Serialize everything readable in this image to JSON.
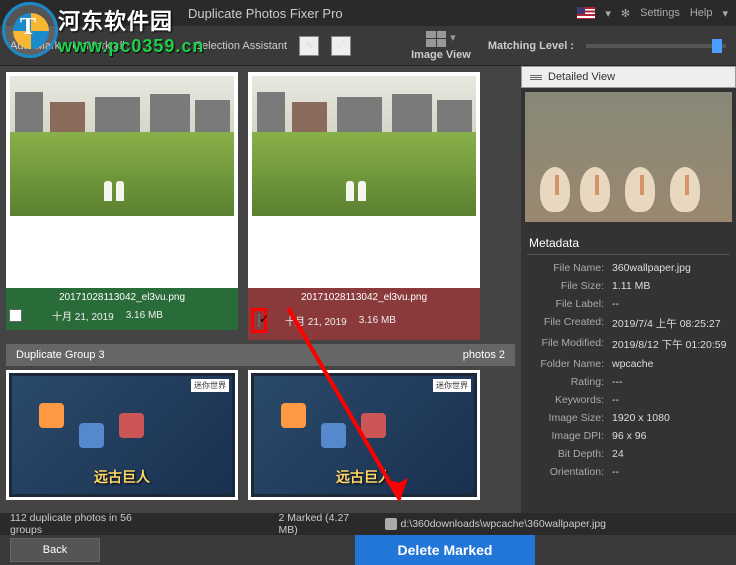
{
  "title": "Duplicate Photos Fixer Pro",
  "titlebar": {
    "settings": "Settings",
    "help": "Help",
    "locale": "en-US"
  },
  "toolbar": {
    "automark": "Auto Mark",
    "unmarkall": "UnMark all",
    "selection": "Selection Assistant",
    "imageview": "Image View",
    "matching": "Matching Level :"
  },
  "photos": [
    {
      "filename": "20171028113042_el3vu.png",
      "date": "十月 21, 2019",
      "size": "3.16 MB",
      "checked": false
    },
    {
      "filename": "20171028113042_el3vu.png",
      "date": "十月 21, 2019",
      "size": "3.16 MB",
      "checked": true
    }
  ],
  "group": {
    "label": "Duplicate Group 3",
    "count": "photos 2"
  },
  "game": {
    "title": "远古巨人",
    "badge": "迷你世界"
  },
  "detail": {
    "label": "Detailed View"
  },
  "metadata": {
    "title": "Metadata",
    "rows": [
      {
        "k": "File Name:",
        "v": "360wallpaper.jpg"
      },
      {
        "k": "File Size:",
        "v": "1.11 MB"
      },
      {
        "k": "File Label:",
        "v": "--"
      },
      {
        "k": "File Created:",
        "v": "2019/7/4 上午 08:25:27"
      },
      {
        "k": "File Modified:",
        "v": "2019/8/12 下午 01:20:59"
      },
      {
        "k": "Folder Name:",
        "v": "wpcache"
      },
      {
        "k": "Rating:",
        "v": "---"
      },
      {
        "k": "Keywords:",
        "v": "--"
      },
      {
        "k": "Image Size:",
        "v": "1920 x 1080"
      },
      {
        "k": "Image DPI:",
        "v": "96 x 96"
      },
      {
        "k": "Bit Depth:",
        "v": "24"
      },
      {
        "k": "Orientation:",
        "v": "--"
      }
    ]
  },
  "status": {
    "groups": "112 duplicate photos in 56 groups",
    "marked": "2 Marked (4.27 MB)",
    "path": "d:\\360downloads\\wpcache\\360wallpaper.jpg"
  },
  "footer": {
    "back": "Back",
    "delete": "Delete Marked"
  },
  "watermark": {
    "brand": "河东软件园",
    "url": "www.pc0359.cn"
  }
}
